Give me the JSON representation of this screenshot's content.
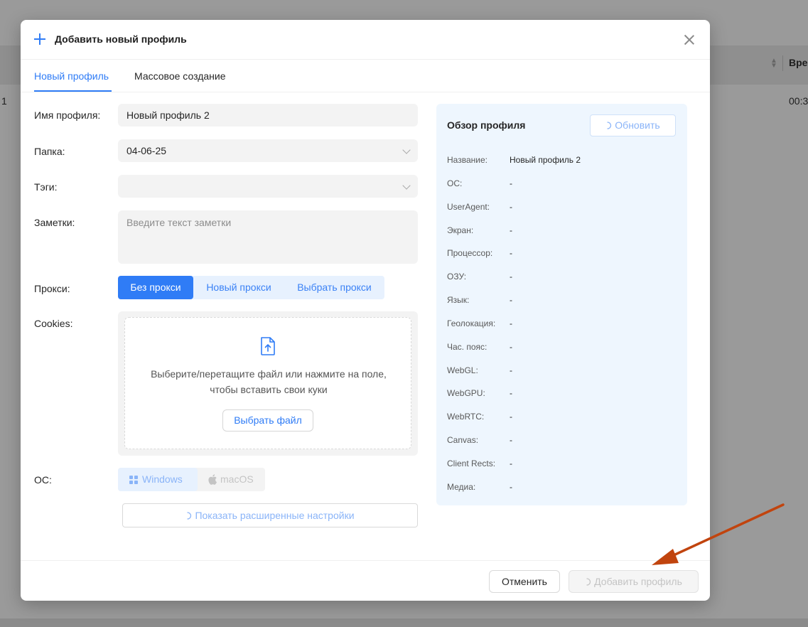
{
  "background": {
    "column_header": "Вре",
    "row_number": "1",
    "row_time": "00:3"
  },
  "modal": {
    "title": "Добавить новый профиль",
    "tabs": [
      {
        "label": "Новый профиль",
        "active": true
      },
      {
        "label": "Массовое создание",
        "active": false
      }
    ],
    "form": {
      "profile_name": {
        "label": "Имя профиля:",
        "value": "Новый профиль 2"
      },
      "folder": {
        "label": "Папка:",
        "value": "04-06-25"
      },
      "tags": {
        "label": "Тэги:",
        "value": ""
      },
      "notes": {
        "label": "Заметки:",
        "placeholder": "Введите текст заметки"
      },
      "proxy": {
        "label": "Прокси:",
        "options": [
          "Без прокси",
          "Новый прокси",
          "Выбрать прокси"
        ],
        "selected": "Без прокси"
      },
      "cookies": {
        "label": "Cookies:",
        "hint_line1": "Выберите/перетащите файл или нажмите на поле,",
        "hint_line2": "чтобы вставить свои куки",
        "choose_file": "Выбрать файл"
      },
      "os": {
        "label": "ОС:",
        "options": [
          "Windows",
          "macOS"
        ],
        "selected": "Windows"
      },
      "advanced_button": "Показать расширенные настройки"
    },
    "overview": {
      "title": "Обзор профиля",
      "refresh_button": "Обновить",
      "rows": [
        {
          "label": "Название:",
          "value": "Новый профиль 2"
        },
        {
          "label": "ОС:",
          "value": "-"
        },
        {
          "label": "UserAgent:",
          "value": "-"
        },
        {
          "label": "Экран:",
          "value": "-"
        },
        {
          "label": "Процессор:",
          "value": "-"
        },
        {
          "label": "ОЗУ:",
          "value": "-"
        },
        {
          "label": "Язык:",
          "value": "-"
        },
        {
          "label": "Геолокация:",
          "value": "-"
        },
        {
          "label": "Час. пояс:",
          "value": "-"
        },
        {
          "label": "WebGL:",
          "value": "-"
        },
        {
          "label": "WebGPU:",
          "value": "-"
        },
        {
          "label": "WebRTC:",
          "value": "-"
        },
        {
          "label": "Canvas:",
          "value": "-"
        },
        {
          "label": "Client Rects:",
          "value": "-"
        },
        {
          "label": "Медиа:",
          "value": "-"
        }
      ]
    },
    "footer": {
      "cancel": "Отменить",
      "submit": "Добавить профиль"
    }
  },
  "colors": {
    "accent": "#2f7cf6",
    "overview_bg": "#eef6fe",
    "annotation_arrow": "#c1440e"
  },
  "icons": [
    "plus-icon",
    "close-icon",
    "chevron-down-icon",
    "file-upload-icon",
    "windows-icon",
    "apple-icon",
    "loading-icon"
  ]
}
